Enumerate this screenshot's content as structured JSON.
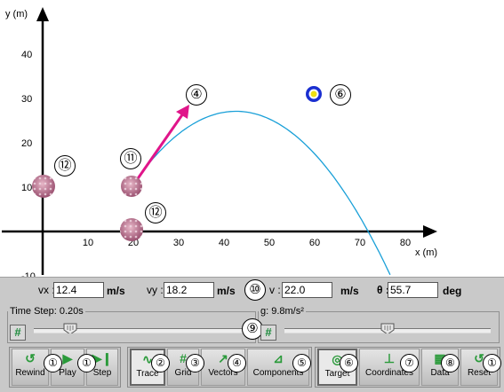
{
  "plot": {
    "y_axis_label": "y (m)",
    "x_axis_label": "x (m)",
    "y_ticks": [
      "40",
      "30",
      "20",
      "10",
      "-10"
    ],
    "x_ticks": [
      "10",
      "20",
      "30",
      "40",
      "50",
      "60",
      "70",
      "80"
    ],
    "colors": {
      "trajectory": "#1aa0d8",
      "velocity_arrow": "#e0158a",
      "target_outer": "#1a2fd0",
      "target_inner": "#f0e010",
      "ball": "#c07890"
    },
    "markers": {
      "cannonball": "⑪",
      "vector_arrow": "④",
      "target": "⑥",
      "ball_left": "⑫",
      "ball_bottom": "⑫"
    }
  },
  "readout": {
    "vx_label": "vx :",
    "vx_value": "12.4",
    "vx_unit": "m/s",
    "vy_label": "vy :",
    "vy_value": "18.2",
    "vy_unit": "m/s",
    "marker_v": "⑩",
    "v_label": "v :",
    "v_value": "22.0",
    "v_unit": "m/s",
    "theta_label": "θ :",
    "theta_value": "55.7",
    "theta_unit": "deg"
  },
  "timestep": {
    "label": "Time Step: 0.20s",
    "hash": "#",
    "level": 0.17
  },
  "gravity": {
    "label": "g: 9.8m/s²",
    "hash": "#",
    "level": 0.5
  },
  "marker_sliders": "⑨",
  "toolbar": {
    "rewind": "Rewind",
    "play": "Play",
    "step": "Step",
    "trace": "Trace",
    "grid": "Grid",
    "vectors": "Vectors",
    "components": "Components",
    "target": "Target",
    "coordinates": "Coordinates",
    "data": "Data",
    "reset": "Reset",
    "markers": [
      "①",
      "①",
      "②",
      "③",
      "④",
      "⑤",
      "⑥",
      "⑦",
      "⑧",
      "①"
    ]
  }
}
